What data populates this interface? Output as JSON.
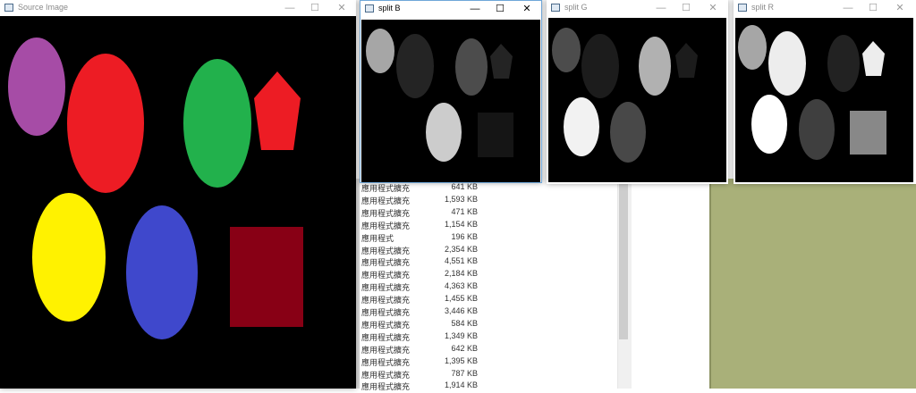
{
  "windows": {
    "source": {
      "title": "Source Image"
    },
    "split_b": {
      "title": "split B"
    },
    "split_g": {
      "title": "split G"
    },
    "split_r": {
      "title": "split R"
    }
  },
  "titlebar_buttons": {
    "minimize": "—",
    "maximize": "☐",
    "close": "✕"
  },
  "file_list": [
    {
      "name": "應用程式擴充",
      "size": "641 KB"
    },
    {
      "name": "應用程式擴充",
      "size": "1,593 KB"
    },
    {
      "name": "應用程式擴充",
      "size": "471 KB"
    },
    {
      "name": "應用程式擴充",
      "size": "1,154 KB"
    },
    {
      "name": "應用程式",
      "size": "196 KB"
    },
    {
      "name": "應用程式擴充",
      "size": "2,354 KB"
    },
    {
      "name": "應用程式擴充",
      "size": "4,551 KB"
    },
    {
      "name": "應用程式擴充",
      "size": "2,184 KB"
    },
    {
      "name": "應用程式擴充",
      "size": "4,363 KB"
    },
    {
      "name": "應用程式擴充",
      "size": "1,455 KB"
    },
    {
      "name": "應用程式擴充",
      "size": "3,446 KB"
    },
    {
      "name": "應用程式擴充",
      "size": "584 KB"
    },
    {
      "name": "應用程式擴充",
      "size": "1,349 KB"
    },
    {
      "name": "應用程式擴充",
      "size": "642 KB"
    },
    {
      "name": "應用程式擴充",
      "size": "1,395 KB"
    },
    {
      "name": "應用程式擴充",
      "size": "787 KB"
    },
    {
      "name": "應用程式擴充",
      "size": "1,914 KB"
    }
  ],
  "colors": {
    "purple": "#a64ca6",
    "red": "#ed1c24",
    "green": "#22b14c",
    "yellow": "#fff200",
    "blue": "#3f48cc",
    "dark_red": "#880015"
  }
}
